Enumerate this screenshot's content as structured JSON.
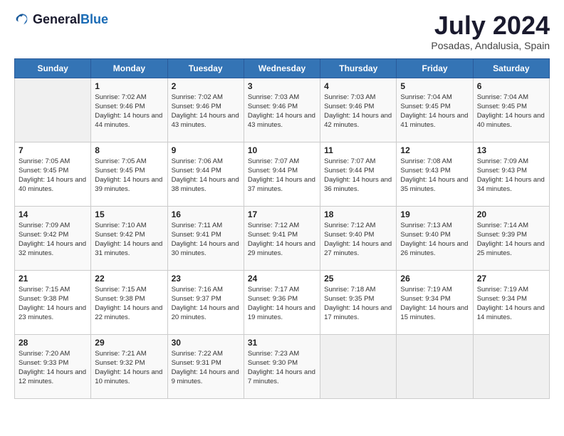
{
  "header": {
    "logo_general": "General",
    "logo_blue": "Blue",
    "month": "July 2024",
    "location": "Posadas, Andalusia, Spain"
  },
  "weekdays": [
    "Sunday",
    "Monday",
    "Tuesday",
    "Wednesday",
    "Thursday",
    "Friday",
    "Saturday"
  ],
  "weeks": [
    [
      {
        "day": "",
        "sunrise": "",
        "sunset": "",
        "daylight": ""
      },
      {
        "day": "1",
        "sunrise": "Sunrise: 7:02 AM",
        "sunset": "Sunset: 9:46 PM",
        "daylight": "Daylight: 14 hours and 44 minutes."
      },
      {
        "day": "2",
        "sunrise": "Sunrise: 7:02 AM",
        "sunset": "Sunset: 9:46 PM",
        "daylight": "Daylight: 14 hours and 43 minutes."
      },
      {
        "day": "3",
        "sunrise": "Sunrise: 7:03 AM",
        "sunset": "Sunset: 9:46 PM",
        "daylight": "Daylight: 14 hours and 43 minutes."
      },
      {
        "day": "4",
        "sunrise": "Sunrise: 7:03 AM",
        "sunset": "Sunset: 9:46 PM",
        "daylight": "Daylight: 14 hours and 42 minutes."
      },
      {
        "day": "5",
        "sunrise": "Sunrise: 7:04 AM",
        "sunset": "Sunset: 9:45 PM",
        "daylight": "Daylight: 14 hours and 41 minutes."
      },
      {
        "day": "6",
        "sunrise": "Sunrise: 7:04 AM",
        "sunset": "Sunset: 9:45 PM",
        "daylight": "Daylight: 14 hours and 40 minutes."
      }
    ],
    [
      {
        "day": "7",
        "sunrise": "Sunrise: 7:05 AM",
        "sunset": "Sunset: 9:45 PM",
        "daylight": "Daylight: 14 hours and 40 minutes."
      },
      {
        "day": "8",
        "sunrise": "Sunrise: 7:05 AM",
        "sunset": "Sunset: 9:45 PM",
        "daylight": "Daylight: 14 hours and 39 minutes."
      },
      {
        "day": "9",
        "sunrise": "Sunrise: 7:06 AM",
        "sunset": "Sunset: 9:44 PM",
        "daylight": "Daylight: 14 hours and 38 minutes."
      },
      {
        "day": "10",
        "sunrise": "Sunrise: 7:07 AM",
        "sunset": "Sunset: 9:44 PM",
        "daylight": "Daylight: 14 hours and 37 minutes."
      },
      {
        "day": "11",
        "sunrise": "Sunrise: 7:07 AM",
        "sunset": "Sunset: 9:44 PM",
        "daylight": "Daylight: 14 hours and 36 minutes."
      },
      {
        "day": "12",
        "sunrise": "Sunrise: 7:08 AM",
        "sunset": "Sunset: 9:43 PM",
        "daylight": "Daylight: 14 hours and 35 minutes."
      },
      {
        "day": "13",
        "sunrise": "Sunrise: 7:09 AM",
        "sunset": "Sunset: 9:43 PM",
        "daylight": "Daylight: 14 hours and 34 minutes."
      }
    ],
    [
      {
        "day": "14",
        "sunrise": "Sunrise: 7:09 AM",
        "sunset": "Sunset: 9:42 PM",
        "daylight": "Daylight: 14 hours and 32 minutes."
      },
      {
        "day": "15",
        "sunrise": "Sunrise: 7:10 AM",
        "sunset": "Sunset: 9:42 PM",
        "daylight": "Daylight: 14 hours and 31 minutes."
      },
      {
        "day": "16",
        "sunrise": "Sunrise: 7:11 AM",
        "sunset": "Sunset: 9:41 PM",
        "daylight": "Daylight: 14 hours and 30 minutes."
      },
      {
        "day": "17",
        "sunrise": "Sunrise: 7:12 AM",
        "sunset": "Sunset: 9:41 PM",
        "daylight": "Daylight: 14 hours and 29 minutes."
      },
      {
        "day": "18",
        "sunrise": "Sunrise: 7:12 AM",
        "sunset": "Sunset: 9:40 PM",
        "daylight": "Daylight: 14 hours and 27 minutes."
      },
      {
        "day": "19",
        "sunrise": "Sunrise: 7:13 AM",
        "sunset": "Sunset: 9:40 PM",
        "daylight": "Daylight: 14 hours and 26 minutes."
      },
      {
        "day": "20",
        "sunrise": "Sunrise: 7:14 AM",
        "sunset": "Sunset: 9:39 PM",
        "daylight": "Daylight: 14 hours and 25 minutes."
      }
    ],
    [
      {
        "day": "21",
        "sunrise": "Sunrise: 7:15 AM",
        "sunset": "Sunset: 9:38 PM",
        "daylight": "Daylight: 14 hours and 23 minutes."
      },
      {
        "day": "22",
        "sunrise": "Sunrise: 7:15 AM",
        "sunset": "Sunset: 9:38 PM",
        "daylight": "Daylight: 14 hours and 22 minutes."
      },
      {
        "day": "23",
        "sunrise": "Sunrise: 7:16 AM",
        "sunset": "Sunset: 9:37 PM",
        "daylight": "Daylight: 14 hours and 20 minutes."
      },
      {
        "day": "24",
        "sunrise": "Sunrise: 7:17 AM",
        "sunset": "Sunset: 9:36 PM",
        "daylight": "Daylight: 14 hours and 19 minutes."
      },
      {
        "day": "25",
        "sunrise": "Sunrise: 7:18 AM",
        "sunset": "Sunset: 9:35 PM",
        "daylight": "Daylight: 14 hours and 17 minutes."
      },
      {
        "day": "26",
        "sunrise": "Sunrise: 7:19 AM",
        "sunset": "Sunset: 9:34 PM",
        "daylight": "Daylight: 14 hours and 15 minutes."
      },
      {
        "day": "27",
        "sunrise": "Sunrise: 7:19 AM",
        "sunset": "Sunset: 9:34 PM",
        "daylight": "Daylight: 14 hours and 14 minutes."
      }
    ],
    [
      {
        "day": "28",
        "sunrise": "Sunrise: 7:20 AM",
        "sunset": "Sunset: 9:33 PM",
        "daylight": "Daylight: 14 hours and 12 minutes."
      },
      {
        "day": "29",
        "sunrise": "Sunrise: 7:21 AM",
        "sunset": "Sunset: 9:32 PM",
        "daylight": "Daylight: 14 hours and 10 minutes."
      },
      {
        "day": "30",
        "sunrise": "Sunrise: 7:22 AM",
        "sunset": "Sunset: 9:31 PM",
        "daylight": "Daylight: 14 hours and 9 minutes."
      },
      {
        "day": "31",
        "sunrise": "Sunrise: 7:23 AM",
        "sunset": "Sunset: 9:30 PM",
        "daylight": "Daylight: 14 hours and 7 minutes."
      },
      {
        "day": "",
        "sunrise": "",
        "sunset": "",
        "daylight": ""
      },
      {
        "day": "",
        "sunrise": "",
        "sunset": "",
        "daylight": ""
      },
      {
        "day": "",
        "sunrise": "",
        "sunset": "",
        "daylight": ""
      }
    ]
  ]
}
